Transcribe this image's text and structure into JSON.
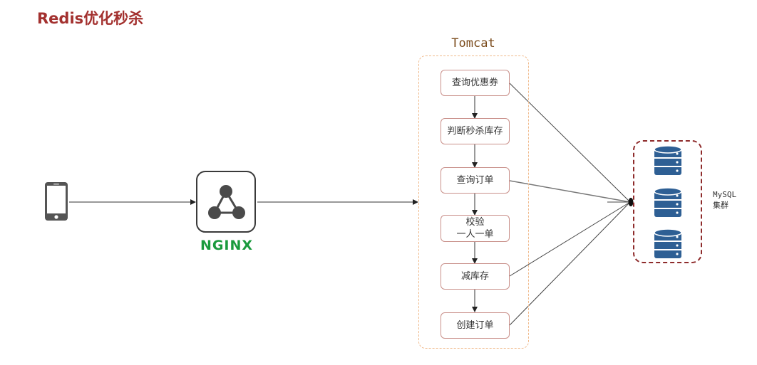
{
  "title": "Redis优化秒杀",
  "nginx": {
    "logo_text": "NGINX"
  },
  "tomcat": {
    "title": "Tomcat",
    "steps": [
      "查询优惠券",
      "判断秒杀库存",
      "查询订单",
      "校验\n一人一单",
      "减库存",
      "创建订单"
    ]
  },
  "mysql": {
    "label": "MySQL\n集群"
  },
  "colors": {
    "title": "#a3312f",
    "nginx_green": "#1a9a3d",
    "tomcat_border": "#f0b98a",
    "step_border": "#c9908a",
    "mysql_border": "#8e2b2b",
    "db_blue": "#2e5f94"
  }
}
